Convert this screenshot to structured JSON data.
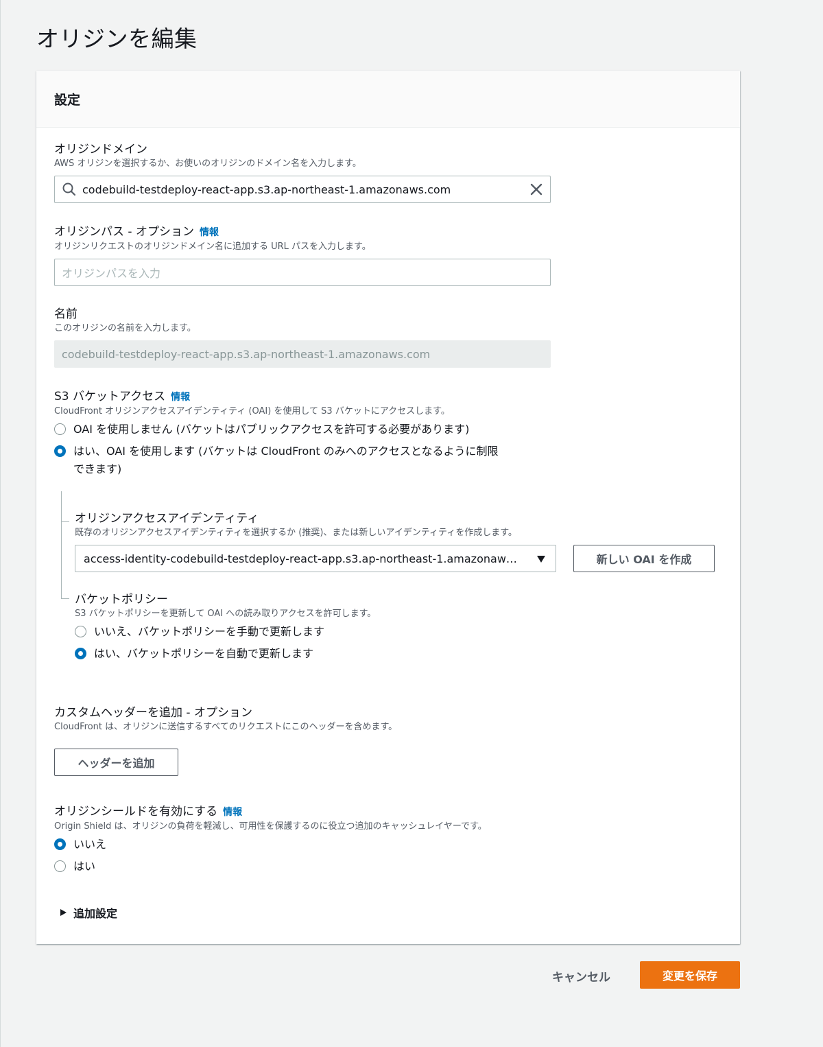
{
  "page": {
    "title": "オリジンを編集"
  },
  "settings": {
    "header": "設定",
    "origin_domain": {
      "label": "オリジンドメイン",
      "description": "AWS オリジンを選択するか、お使いのオリジンのドメイン名を入力します。",
      "value": "codebuild-testdeploy-react-app.s3.ap-northeast-1.amazonaws.com"
    },
    "origin_path": {
      "label": "オリジンパス - オプション",
      "info": "情報",
      "description": "オリジンリクエストのオリジンドメイン名に追加する URL パスを入力します。",
      "placeholder": "オリジンパスを入力"
    },
    "name": {
      "label": "名前",
      "description": "このオリジンの名前を入力します。",
      "value": "codebuild-testdeploy-react-app.s3.ap-northeast-1.amazonaws.com"
    },
    "s3_access": {
      "label": "S3 バケットアクセス",
      "info": "情報",
      "description": "CloudFront オリジンアクセスアイデンティティ (OAI) を使用して S3 バケットにアクセスします。",
      "options": [
        {
          "label": "OAI を使用しません (バケットはパブリックアクセスを許可する必要があります)",
          "checked": false
        },
        {
          "label": "はい、OAI を使用します (バケットは CloudFront のみへのアクセスとなるように制限",
          "label2": "できます)",
          "checked": true
        }
      ]
    },
    "oai": {
      "label": "オリジンアクセスアイデンティティ",
      "description": "既存のオリジンアクセスアイデンティティを選択するか (推奨)、または新しいアイデンティティを作成します。",
      "selected": "access-identity-codebuild-testdeploy-react-app.s3.ap-northeast-1.amazonaw…",
      "create_button": "新しい OAI を作成"
    },
    "bucket_policy": {
      "label": "バケットポリシー",
      "description": "S3 バケットポリシーを更新して OAI への読み取りアクセスを許可します。",
      "options": [
        {
          "label": "いいえ、バケットポリシーを手動で更新します",
          "checked": false
        },
        {
          "label": "はい、バケットポリシーを自動で更新します",
          "checked": true
        }
      ]
    },
    "custom_header": {
      "label": "カスタムヘッダーを追加 - オプション",
      "description": "CloudFront は、オリジンに送信するすべてのリクエストにこのヘッダーを含めます。",
      "button": "ヘッダーを追加"
    },
    "origin_shield": {
      "label": "オリジンシールドを有効にする",
      "info": "情報",
      "description": "Origin Shield は、オリジンの負荷を軽減し、可用性を保護するのに役立つ追加のキャッシュレイヤーです。",
      "options": [
        {
          "label": "いいえ",
          "checked": true
        },
        {
          "label": "はい",
          "checked": false
        }
      ]
    },
    "additional": {
      "label": "追加設定"
    }
  },
  "footer": {
    "cancel": "キャンセル",
    "save": "変更を保存"
  },
  "colors": {
    "accent": "#0073bb",
    "primary": "#ec7211"
  }
}
